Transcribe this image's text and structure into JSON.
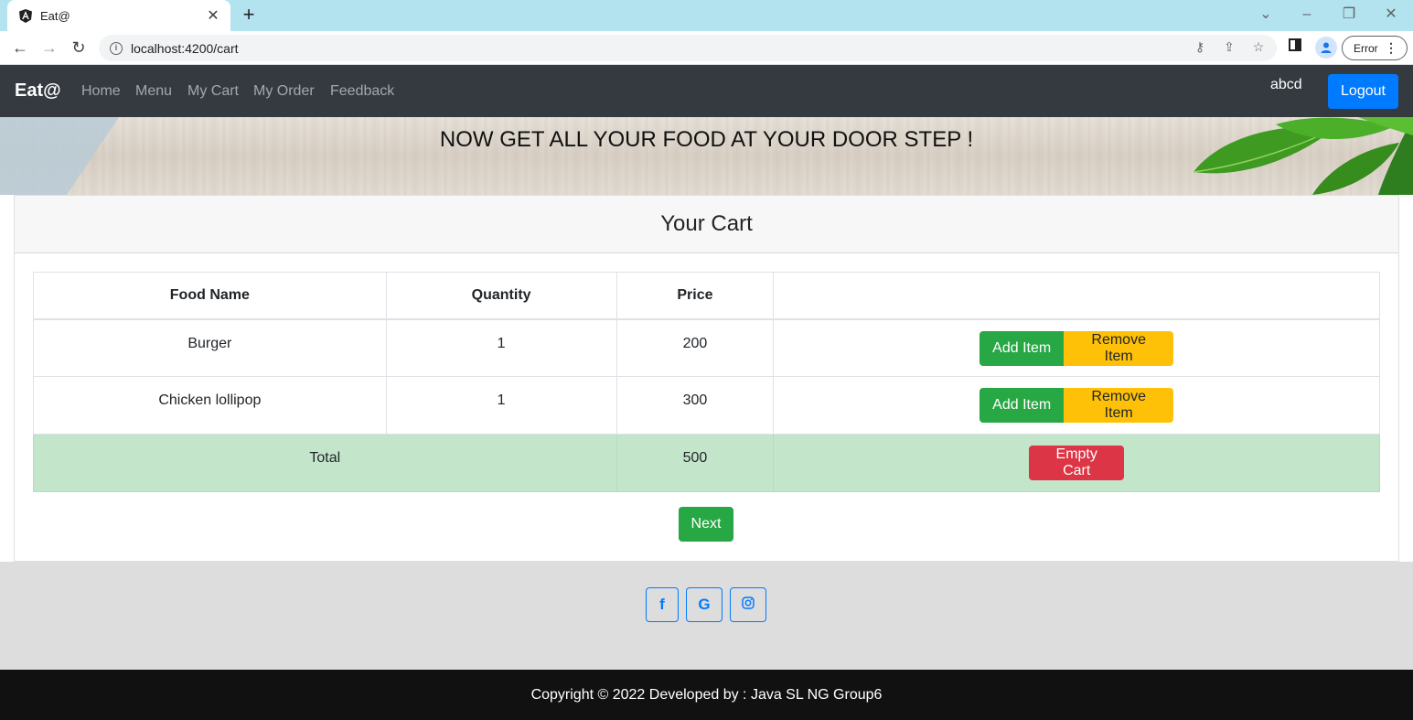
{
  "browser": {
    "tab_title": "Eat@",
    "url": "localhost:4200/cart",
    "error_label": "Error",
    "icons": [
      "angular-favicon",
      "close-icon",
      "plus-icon",
      "back-icon",
      "forward-icon",
      "reload-icon",
      "info-icon",
      "key-icon",
      "share-icon",
      "star-icon",
      "sidepanel-icon",
      "profile-icon",
      "kebab-menu-icon",
      "minimize-icon",
      "restore-icon",
      "close-window-icon",
      "chevron-down-icon"
    ]
  },
  "navbar": {
    "brand": "Eat@",
    "links": [
      "Home",
      "Menu",
      "My Cart",
      "My Order",
      "Feedback"
    ],
    "username": "abcd",
    "logout_label": "Logout"
  },
  "banner": {
    "text": "NOW GET ALL YOUR FOOD AT YOUR DOOR STEP !"
  },
  "cart": {
    "title": "Your Cart",
    "headers": [
      "Food Name",
      "Quantity",
      "Price",
      ""
    ],
    "rows": [
      {
        "food": "Burger",
        "quantity": "1",
        "price": "200",
        "add_label": "Add Item",
        "remove_label": "Remove Item"
      },
      {
        "food": "Chicken lollipop",
        "quantity": "1",
        "price": "300",
        "add_label": "Add Item",
        "remove_label": "Remove Item"
      }
    ],
    "total_label": "Total",
    "total_value": "500",
    "empty_label": "Empty Cart",
    "next_label": "Next"
  },
  "social": {
    "facebook_glyph": "f",
    "google_glyph": "G",
    "icons": [
      "facebook-icon",
      "google-icon",
      "instagram-icon"
    ]
  },
  "footer": {
    "copyright": "Copyright © 2022 Developed by : Java SL NG Group6"
  },
  "colors": {
    "navbar_bg": "#343a40",
    "primary": "#007bff",
    "success": "#28a745",
    "warning": "#ffc107",
    "danger": "#dc3545",
    "total_row": "#c3e6cb",
    "footer_bg": "#111111"
  }
}
